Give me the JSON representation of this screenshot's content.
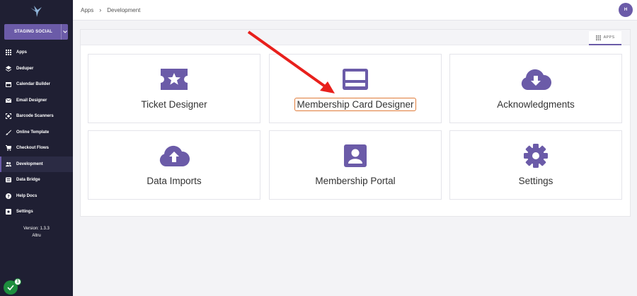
{
  "sidebar": {
    "org_name": "STAGING SOCIAL",
    "items": [
      {
        "label": "Apps",
        "icon": "grid-icon"
      },
      {
        "label": "Deduper",
        "icon": "layers-icon"
      },
      {
        "label": "Calendar Builder",
        "icon": "calendar-icon"
      },
      {
        "label": "Email Designer",
        "icon": "mail-icon"
      },
      {
        "label": "Barcode Scanners",
        "icon": "scanner-icon"
      },
      {
        "label": "Online Template",
        "icon": "brush-icon"
      },
      {
        "label": "Checkout Flows",
        "icon": "cart-icon"
      },
      {
        "label": "Development",
        "icon": "people-icon",
        "active": true
      },
      {
        "label": "Data Bridge",
        "icon": "database-icon"
      },
      {
        "label": "Help Docs",
        "icon": "help-icon"
      },
      {
        "label": "Settings",
        "icon": "gear-icon"
      }
    ],
    "version": "Version: 1.3.3",
    "product": "Altru",
    "help_badge": "1"
  },
  "topbar": {
    "breadcrumb": [
      "Apps",
      "Development"
    ],
    "avatar_initial": "H"
  },
  "panel": {
    "tab_label": "APPS",
    "cards": [
      {
        "title": "Ticket Designer",
        "icon": "ticket-star-icon"
      },
      {
        "title": "Membership Card Designer",
        "icon": "card-icon",
        "highlighted": true
      },
      {
        "title": "Acknowledgments",
        "icon": "cloud-download-icon"
      },
      {
        "title": "Data Imports",
        "icon": "cloud-upload-icon"
      },
      {
        "title": "Membership Portal",
        "icon": "portrait-icon"
      },
      {
        "title": "Settings",
        "icon": "gear-icon"
      }
    ]
  },
  "colors": {
    "sidebar_bg": "#1f1f33",
    "accent": "#6b5ba8",
    "highlight_outline": "#e07b39",
    "annotation_arrow": "#e8201c"
  }
}
